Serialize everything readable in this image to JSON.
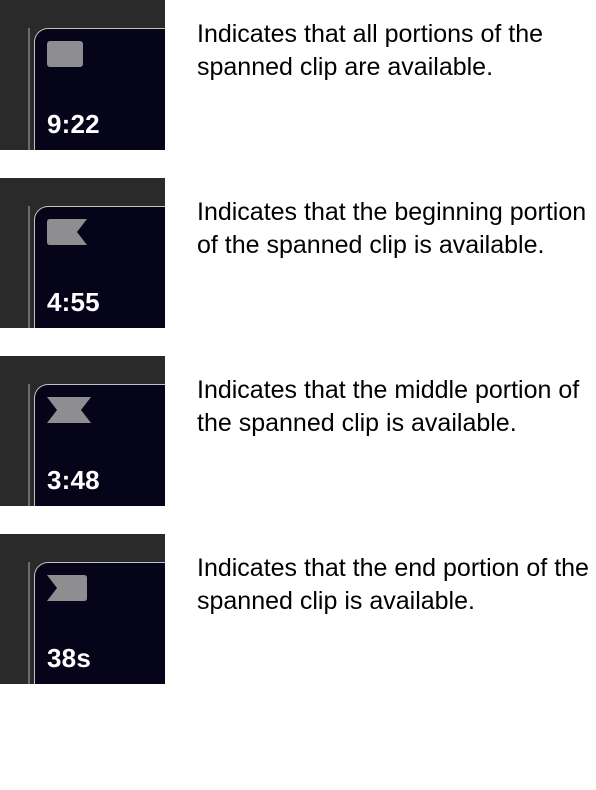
{
  "rows": [
    {
      "badge_name": "span-all-icon",
      "time": "9:22",
      "description": "Indicates that all portions of the spanned clip are available."
    },
    {
      "badge_name": "span-begin-icon",
      "time": "4:55",
      "description": "Indicates that the beginning portion of the spanned clip is available."
    },
    {
      "badge_name": "span-middle-icon",
      "time": "3:48",
      "description": "Indicates that the middle portion of the spanned clip is available."
    },
    {
      "badge_name": "span-end-icon",
      "time": "38s",
      "description": "Indicates that the end portion of the spanned clip is available."
    }
  ],
  "colors": {
    "badge_fill": "#8e8e91"
  }
}
